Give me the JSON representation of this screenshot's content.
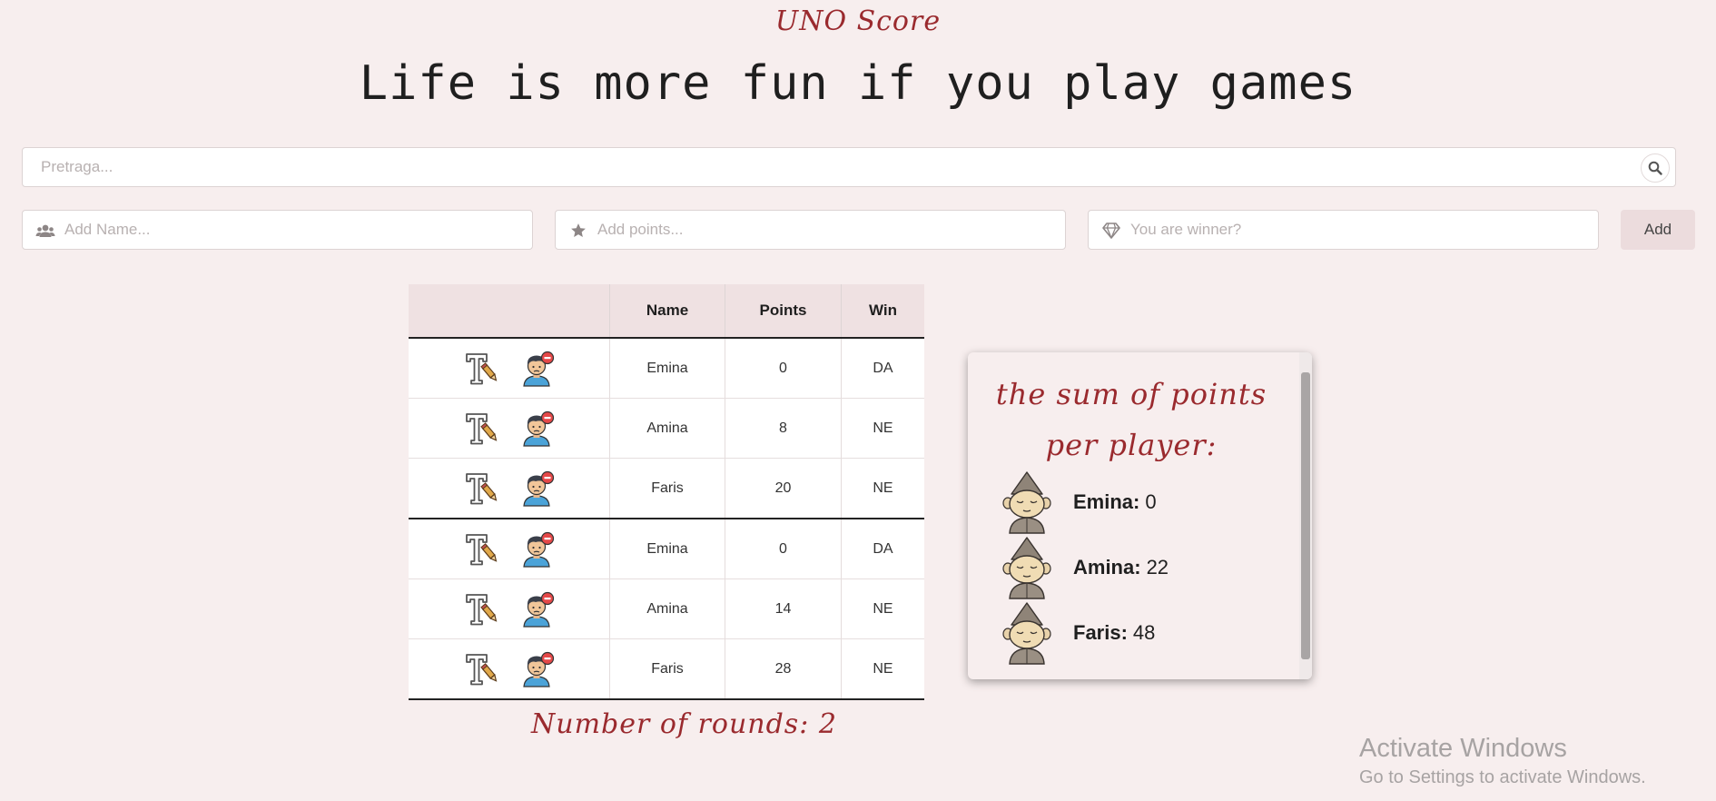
{
  "app_title": "UNO Score",
  "headline": "Life is more fun if you play games",
  "search": {
    "placeholder": "Pretraga..."
  },
  "add_form": {
    "name_placeholder": "Add Name...",
    "points_placeholder": "Add points...",
    "winner_placeholder": "You are winner?",
    "add_label": "Add"
  },
  "table": {
    "headers": {
      "actions": "",
      "name": "Name",
      "points": "Points",
      "win": "Win"
    },
    "rows": [
      {
        "name": "Emina",
        "points": "0",
        "win": "DA"
      },
      {
        "name": "Amina",
        "points": "8",
        "win": "NE"
      },
      {
        "name": "Faris",
        "points": "20",
        "win": "NE"
      },
      {
        "name": "Emina",
        "points": "0",
        "win": "DA"
      },
      {
        "name": "Amina",
        "points": "14",
        "win": "NE"
      },
      {
        "name": "Faris",
        "points": "28",
        "win": "NE"
      }
    ]
  },
  "rounds_text": "Number of rounds: 2",
  "sum_panel": {
    "title_line1": "the sum of points",
    "title_line2": "per player:",
    "players": [
      {
        "name": "Emina:",
        "total": "0"
      },
      {
        "name": "Amina:",
        "total": "22"
      },
      {
        "name": "Faris:",
        "total": "48"
      }
    ]
  },
  "windows_watermark": {
    "title": "Activate Windows",
    "subtitle": "Go to Settings to activate Windows."
  },
  "icons": {
    "search": "search-icon",
    "users": "users-icon",
    "star": "star-icon",
    "diamond": "diamond-icon",
    "edit": "edit-text-icon",
    "delete_user": "remove-user-icon",
    "avatar": "gnome-avatar-icon"
  },
  "colors": {
    "background": "#f7eeee",
    "accent_script": "#9a2a2e",
    "header_bg": "#efe1e2",
    "add_button_bg": "#ecdcdd"
  }
}
